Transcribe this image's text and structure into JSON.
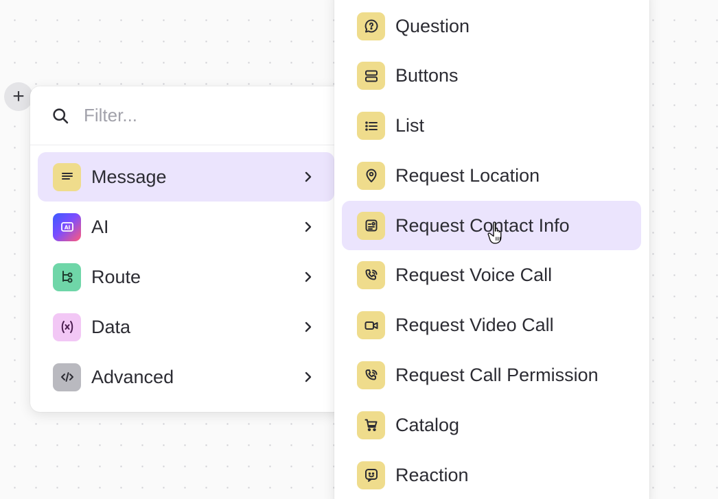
{
  "add_button": {
    "symbol": "+"
  },
  "filter": {
    "placeholder": "Filter...",
    "value": ""
  },
  "categories": [
    {
      "label": "Message",
      "icon": "message-lines-icon",
      "color": "#efdc8c",
      "active": true
    },
    {
      "label": "AI",
      "icon": "ai-icon",
      "color": "#7b4dff"
    },
    {
      "label": "Route",
      "icon": "route-icon",
      "color": "#6fd6a8"
    },
    {
      "label": "Data",
      "icon": "variable-icon",
      "color": "#f2c7f5"
    },
    {
      "label": "Advanced",
      "icon": "code-icon",
      "color": "#b9b9bf"
    }
  ],
  "submenu": [
    {
      "label": "Question",
      "icon": "question-bubble-icon"
    },
    {
      "label": "Buttons",
      "icon": "buttons-icon"
    },
    {
      "label": "List",
      "icon": "list-icon"
    },
    {
      "label": "Request Location",
      "icon": "location-pin-icon"
    },
    {
      "label": "Request Contact Info",
      "icon": "contact-card-icon",
      "hovered": true
    },
    {
      "label": "Request Voice Call",
      "icon": "phone-call-icon"
    },
    {
      "label": "Request Video Call",
      "icon": "video-camera-icon"
    },
    {
      "label": "Request Call Permission",
      "icon": "phone-call-icon"
    },
    {
      "label": "Catalog",
      "icon": "cart-icon"
    },
    {
      "label": "Reaction",
      "icon": "smiley-icon"
    }
  ],
  "colors": {
    "active_bg": "#ebe4fd",
    "submenu_icon_bg": "#efdc8c"
  }
}
